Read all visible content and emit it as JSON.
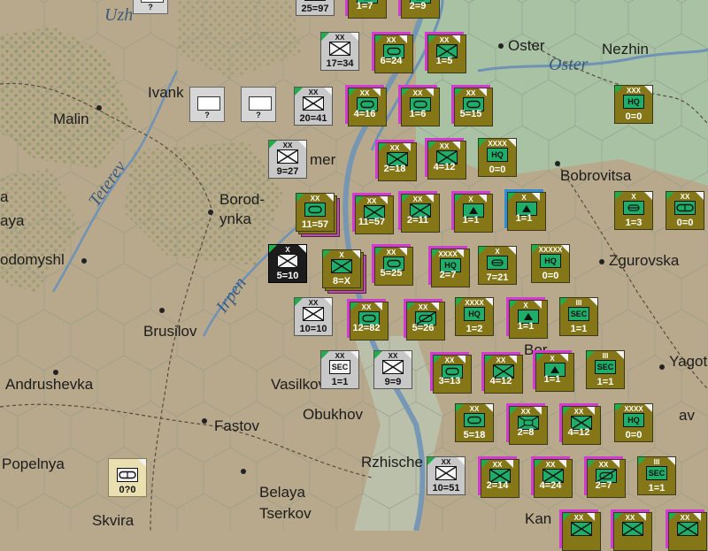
{
  "colors": {
    "land": "#b9a98c",
    "forest": "#9aa774",
    "marsh": "#a6c7a8",
    "river": "#6f93b6",
    "axis_counter": "#857617",
    "soviet_counter": "#c8c8c8",
    "highlight_magenta": "#d33ad3",
    "highlight_blue": "#2a8fd9",
    "unit_symbol": "#1fae6a"
  },
  "map": {
    "cities": [
      {
        "id": "oster",
        "name": "Oster"
      },
      {
        "id": "nezhin",
        "name": "Nezhin"
      },
      {
        "id": "malin",
        "name": "Malin"
      },
      {
        "id": "ivank",
        "name": "Ivank"
      },
      {
        "id": "bobrovitsa",
        "name": "Bobrovitsa"
      },
      {
        "id": "borodyanka",
        "name": "Borod-\nynka"
      },
      {
        "id": "a",
        "name": "a"
      },
      {
        "id": "aya",
        "name": "aya"
      },
      {
        "id": "odomyshl",
        "name": "odomyshl"
      },
      {
        "id": "zgurovska",
        "name": "Zgurovska"
      },
      {
        "id": "brusilov",
        "name": "Brusilov"
      },
      {
        "id": "andrushevka",
        "name": "Andrushevka"
      },
      {
        "id": "vasilkov",
        "name": "Vasilkov"
      },
      {
        "id": "obukhov",
        "name": "Obukhov"
      },
      {
        "id": "fastov",
        "name": "Fastov"
      },
      {
        "id": "yagot",
        "name": "Yagot"
      },
      {
        "id": "popelnya",
        "name": "Popelnya"
      },
      {
        "id": "rzhische",
        "name": "Rzhische"
      },
      {
        "id": "belaya",
        "name": "Belaya\nTserkov"
      },
      {
        "id": "skvira",
        "name": "Skvira"
      },
      {
        "id": "kan",
        "name": "Kan"
      },
      {
        "id": "mer",
        "name": "mer"
      },
      {
        "id": "av",
        "name": "av"
      },
      {
        "id": "bor",
        "name": "Bor"
      }
    ],
    "rivers": [
      {
        "id": "oster_river",
        "name": "Oster"
      },
      {
        "id": "teterev",
        "name": "Teterev"
      },
      {
        "id": "irpen",
        "name": "Irpen"
      },
      {
        "id": "uzh",
        "name": "Uzh"
      }
    ]
  },
  "counters": [
    {
      "id": "c1",
      "size": "",
      "sym": "?",
      "val": "?",
      "side": "gr"
    },
    {
      "id": "c2",
      "size": "XX",
      "sym": "inf",
      "val": "25=97",
      "side": "gr"
    },
    {
      "id": "c3",
      "size": "XX",
      "sym": "arm",
      "val": "1=7",
      "side": "ol"
    },
    {
      "id": "c4",
      "size": "XX",
      "sym": "arm",
      "val": "2=9",
      "side": "ol"
    },
    {
      "id": "c5",
      "size": "XX",
      "sym": "inf",
      "val": "17=34",
      "side": "gr"
    },
    {
      "id": "c6",
      "size": "XX",
      "sym": "arm",
      "val": "6=24",
      "side": "ol"
    },
    {
      "id": "c7",
      "size": "XX",
      "sym": "inf",
      "val": "1=5",
      "side": "ol"
    },
    {
      "id": "c8",
      "size": "",
      "sym": "?",
      "val": "?",
      "side": "gr"
    },
    {
      "id": "c9",
      "size": "",
      "sym": "?",
      "val": "?",
      "side": "gr"
    },
    {
      "id": "c10",
      "size": "XX",
      "sym": "inf",
      "val": "20=41",
      "side": "gr"
    },
    {
      "id": "c11",
      "size": "XX",
      "sym": "arm",
      "val": "4=16",
      "side": "ol"
    },
    {
      "id": "c12",
      "size": "XX",
      "sym": "arm",
      "val": "1=6",
      "side": "ol"
    },
    {
      "id": "c13",
      "size": "XX",
      "sym": "arm",
      "val": "5=15",
      "side": "ol"
    },
    {
      "id": "c14",
      "size": "XXX",
      "sym": "HQ",
      "val": "0=0",
      "side": "ol"
    },
    {
      "id": "c15",
      "size": "XX",
      "sym": "inf",
      "val": "9=27",
      "side": "gr"
    },
    {
      "id": "c16",
      "size": "XX",
      "sym": "inf",
      "val": "2=18",
      "side": "ol"
    },
    {
      "id": "c17",
      "size": "XX",
      "sym": "inf",
      "val": "4=12",
      "side": "ol"
    },
    {
      "id": "c18",
      "size": "XXXX",
      "sym": "HQ",
      "val": "0=0",
      "side": "ol"
    },
    {
      "id": "c19",
      "size": "XX",
      "sym": "arm",
      "val": "11=57",
      "side": "ol"
    },
    {
      "id": "c20",
      "size": "XX",
      "sym": "inf",
      "val": "11=57",
      "side": "ol"
    },
    {
      "id": "c21",
      "size": "XX",
      "sym": "inf",
      "val": "2=11",
      "side": "ol"
    },
    {
      "id": "c22",
      "size": "X",
      "sym": "mtn",
      "val": "1=1",
      "side": "ol"
    },
    {
      "id": "c23",
      "size": "X",
      "sym": "mtn",
      "val": "1=1",
      "side": "ol"
    },
    {
      "id": "c24",
      "size": "X",
      "sym": "eng",
      "val": "1=3",
      "side": "ol"
    },
    {
      "id": "c25",
      "size": "XX",
      "sym": "mot",
      "val": "0=0",
      "side": "ol"
    },
    {
      "id": "c26",
      "size": "X",
      "sym": "inf",
      "val": "5=10",
      "side": "bk"
    },
    {
      "id": "c27",
      "size": "X",
      "sym": "inf",
      "val": "8=X",
      "side": "ol"
    },
    {
      "id": "c28",
      "size": "XX",
      "sym": "arm",
      "val": "5=25",
      "side": "ol"
    },
    {
      "id": "c29",
      "size": "XXXX",
      "sym": "HQ",
      "val": "2=7",
      "side": "ol"
    },
    {
      "id": "c30",
      "size": "X",
      "sym": "eng",
      "val": "7=21",
      "side": "ol"
    },
    {
      "id": "c31",
      "size": "XXXXX",
      "sym": "HQ",
      "val": "0=0",
      "side": "ol"
    },
    {
      "id": "c32",
      "size": "XX",
      "sym": "inf",
      "val": "10=10",
      "side": "gr"
    },
    {
      "id": "c33",
      "size": "XX",
      "sym": "arm",
      "val": "12=82",
      "side": "ol"
    },
    {
      "id": "c34",
      "size": "XX",
      "sym": "arm2",
      "val": "5=26",
      "side": "ol"
    },
    {
      "id": "c35",
      "size": "XXXX",
      "sym": "HQ",
      "val": "1=2",
      "side": "ol"
    },
    {
      "id": "c36",
      "size": "X",
      "sym": "mtn",
      "val": "1=1",
      "side": "ol"
    },
    {
      "id": "c37",
      "size": "III",
      "sym": "SEC",
      "val": "1=1",
      "side": "ol"
    },
    {
      "id": "c38",
      "size": "XX",
      "sym": "SEC",
      "val": "1=1",
      "side": "gr"
    },
    {
      "id": "c39",
      "size": "XX",
      "sym": "inf",
      "val": "9=9",
      "side": "gr"
    },
    {
      "id": "c40",
      "size": "XX",
      "sym": "arm",
      "val": "3=13",
      "side": "ol"
    },
    {
      "id": "c41",
      "size": "XX",
      "sym": "inf",
      "val": "4=12",
      "side": "ol"
    },
    {
      "id": "c42",
      "size": "X",
      "sym": "mtn",
      "val": "1=1",
      "side": "ol"
    },
    {
      "id": "c43",
      "size": "III",
      "sym": "SEC",
      "val": "1=1",
      "side": "ol"
    },
    {
      "id": "c44",
      "size": "XX",
      "sym": "arm",
      "val": "5=18",
      "side": "ol"
    },
    {
      "id": "c45",
      "size": "XX",
      "sym": "mot2",
      "val": "2=8",
      "side": "ol"
    },
    {
      "id": "c46",
      "size": "XX",
      "sym": "inf",
      "val": "4=12",
      "side": "ol"
    },
    {
      "id": "c47",
      "size": "XXXX",
      "sym": "HQ",
      "val": "0=0",
      "side": "ol"
    },
    {
      "id": "c48",
      "size": "XX",
      "sym": "inf",
      "val": "10=51",
      "side": "gr"
    },
    {
      "id": "c49",
      "size": "XX",
      "sym": "inf",
      "val": "2=14",
      "side": "ol"
    },
    {
      "id": "c50",
      "size": "XX",
      "sym": "inf",
      "val": "4=24",
      "side": "ol"
    },
    {
      "id": "c51",
      "size": "XX",
      "sym": "arm2",
      "val": "2=7",
      "side": "ol"
    },
    {
      "id": "c52",
      "size": "III",
      "sym": "SEC",
      "val": "1=1",
      "side": "ol"
    },
    {
      "id": "c53",
      "size": "",
      "sym": "mot",
      "val": "0?0",
      "side": "bg"
    },
    {
      "id": "c54",
      "size": "XX",
      "sym": "inf",
      "val": "",
      "side": "ol"
    },
    {
      "id": "c55",
      "size": "XX",
      "sym": "inf",
      "val": "",
      "side": "ol"
    },
    {
      "id": "c56",
      "size": "XX",
      "sym": "inf",
      "val": "",
      "side": "ol"
    }
  ]
}
